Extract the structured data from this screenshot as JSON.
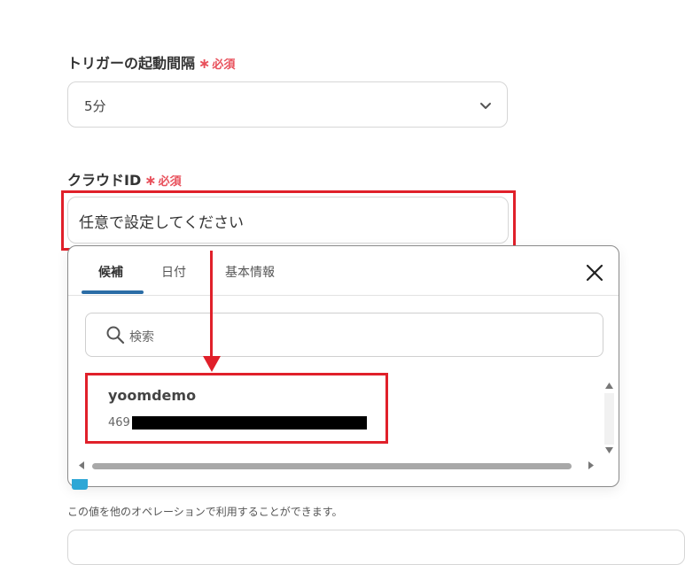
{
  "trigger_interval": {
    "label": "トリガーの起動間隔",
    "required_mark": "∗",
    "required_text": "必須",
    "value": "5分"
  },
  "cloud_id": {
    "label": "クラウドID",
    "required_mark": "∗",
    "required_text": "必須",
    "placeholder": "任意で設定してください"
  },
  "popup": {
    "tabs": [
      {
        "label": "候補",
        "active": true
      },
      {
        "label": "日付",
        "active": false
      },
      {
        "label": "基本情報",
        "active": false
      }
    ],
    "search_placeholder": "検索",
    "results": [
      {
        "name": "yoomdemo",
        "id_prefix": "469"
      }
    ]
  },
  "footnote": "この値を他のオペレーションで利用することができます。",
  "colors": {
    "required": "#e8505b",
    "highlight": "#e0202a",
    "active_tab": "#2b6da6"
  },
  "icons": [
    "chevron-down-icon",
    "close-icon",
    "search-icon",
    "scroll-up-icon",
    "scroll-down-icon",
    "scroll-left-icon",
    "scroll-right-icon"
  ]
}
